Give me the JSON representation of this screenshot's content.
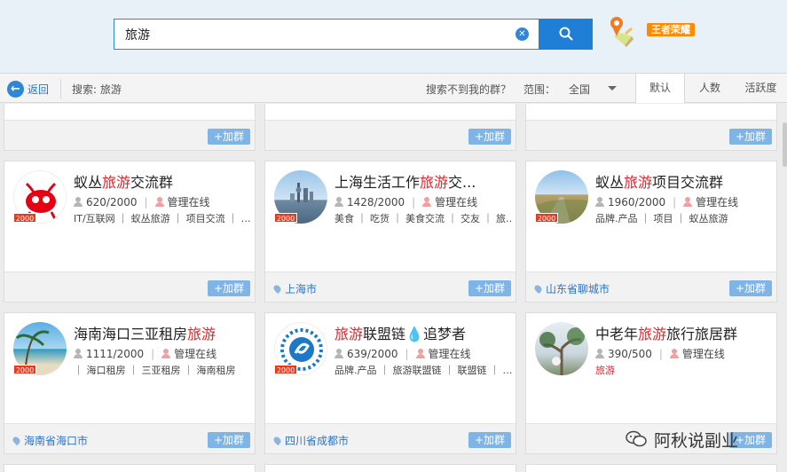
{
  "search": {
    "value": "旅游",
    "clear_icon": "clear-circle-icon",
    "button_icon": "search-icon"
  },
  "header": {
    "location_icon": "map-pin-icon",
    "game_badge": "王者荣耀"
  },
  "filter": {
    "back_label": "返回",
    "search_label": "搜索: 旅游",
    "not_found_label": "搜索不到我的群？",
    "range_label": "范围：",
    "range_value": "全国",
    "sort_tabs": [
      "默认",
      "人数",
      "活跃度"
    ],
    "active_sort": "默认"
  },
  "add_label": "+加群",
  "rows": [
    {
      "cards": [
        {
          "title_prefix": "蚁丛",
          "title_kw": "旅游",
          "title_suffix": "交流群",
          "members": "620/2000",
          "admin": "管理在线",
          "tags": "IT/互联网 ｜ 蚁丛旅游 ｜ 项目交流 ｜ …",
          "capacity": "2000",
          "location": "",
          "avatar": "ant-logo"
        },
        {
          "title_prefix": "上海生活工作",
          "title_kw": "旅游",
          "title_suffix": "交...",
          "members": "1428/2000",
          "admin": "管理在线",
          "tags": "美食 ｜ 吃货 ｜ 美食交流 ｜ 交友 ｜ 旅…",
          "capacity": "2000",
          "location": "上海市",
          "avatar": "shanghai-skyline"
        },
        {
          "title_prefix": "蚁丛",
          "title_kw": "旅游",
          "title_suffix": "项目交流群",
          "members": "1960/2000",
          "admin": "管理在线",
          "tags": "品牌.产品 ｜ 项目 ｜ 蚁丛旅游",
          "capacity": "2000",
          "location": "山东省聊城市",
          "avatar": "road-landscape"
        }
      ]
    },
    {
      "cards": [
        {
          "title_prefix": "海南海口三亚租房",
          "title_kw": "旅游",
          "title_suffix": "",
          "members": "1111/2000",
          "admin": "管理在线",
          "tags": "｜ 海口租房 ｜ 三亚租房 ｜ 海南租房",
          "capacity": "2000",
          "location": "海南省海口市",
          "avatar": "beach-palm"
        },
        {
          "title_prefix": "",
          "title_kw": "旅游",
          "title_suffix": "联盟链💧追梦者",
          "members": "639/2000",
          "admin": "管理在线",
          "tags": "品牌.产品 ｜ 旅游联盟链 ｜ 联盟链 ｜ …",
          "capacity": "2000",
          "location": "四川省成都市",
          "avatar": "chain-logo"
        },
        {
          "title_prefix": "中老年",
          "title_kw": "旅游",
          "title_suffix": "旅行旅居群",
          "members": "390/500",
          "admin": "管理在线",
          "tags": "旅游",
          "capacity": "",
          "location": "",
          "avatar": "tree-photo"
        }
      ]
    }
  ],
  "watermark": "阿秋说副业",
  "colors": {
    "accent": "#2f86d6",
    "keyword": "#e3242b",
    "badge": "#ff8a00"
  }
}
